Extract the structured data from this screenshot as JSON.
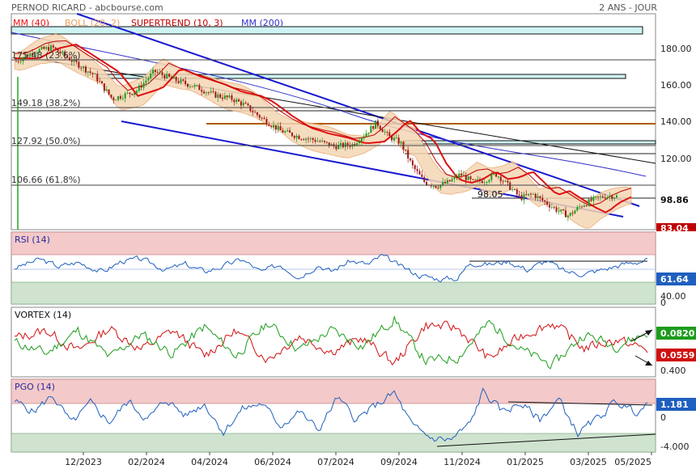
{
  "header": {
    "title": "PERNOD RICARD - abcbourse.com",
    "period": "2 ANS - JOUR"
  },
  "colors": {
    "candle_up": "#1c9c1c",
    "candle_down": "#a01818",
    "mm40": "#e11",
    "boll": "#e8a060",
    "supertrend": "#c00000",
    "mm200": "#3030c8",
    "trend_blue": "#1818d0",
    "rsi": "#1f5fbf",
    "vortex_plus": "#1c9c1c",
    "vortex_minus": "#d01010",
    "pgo": "#1f5fbf",
    "over_zone": "#f3c9c9",
    "under_zone": "#cfe3cf"
  },
  "chart_data": [
    {
      "panel": "price",
      "type": "candlestick",
      "legend": [
        {
          "label": "MM (40)",
          "color": "#e11"
        },
        {
          "label": "BOLL (20, 2)",
          "color": "#e8a060"
        },
        {
          "label": "SUPERTREND (10, 3)",
          "color": "#c00000"
        },
        {
          "label": "MM (200)",
          "color": "#3030c8"
        }
      ],
      "y_ticks": [
        "180.00",
        "160.00",
        "140.00",
        "120.00"
      ],
      "ylim": [
        82,
        191
      ],
      "fibo_levels": [
        {
          "label": "175.48  (23.6%)",
          "value": 175.48
        },
        {
          "label": "149.18  (38.2%)",
          "value": 149.18
        },
        {
          "label": "127.92  (50.0%)",
          "value": 127.92
        },
        {
          "label": "106.66  (61.8%)",
          "value": 106.66
        }
      ],
      "annotations": [
        {
          "label": "98.05",
          "value": 98.05
        }
      ],
      "last_value": "98.86",
      "min_value": "83.04",
      "path": [
        [
          0,
          167
        ],
        [
          0.03,
          172
        ],
        [
          0.06,
          174
        ],
        [
          0.1,
          166
        ],
        [
          0.13,
          160
        ],
        [
          0.16,
          148
        ],
        [
          0.2,
          152
        ],
        [
          0.23,
          162
        ],
        [
          0.26,
          158
        ],
        [
          0.3,
          154
        ],
        [
          0.33,
          150
        ],
        [
          0.36,
          148
        ],
        [
          0.38,
          145
        ],
        [
          0.41,
          138
        ],
        [
          0.44,
          132
        ],
        [
          0.47,
          129
        ],
        [
          0.5,
          127
        ],
        [
          0.53,
          124
        ],
        [
          0.56,
          125
        ],
        [
          0.58,
          130
        ],
        [
          0.6,
          136
        ],
        [
          0.62,
          129
        ],
        [
          0.64,
          126
        ],
        [
          0.66,
          114
        ],
        [
          0.68,
          106
        ],
        [
          0.7,
          104
        ],
        [
          0.72,
          106
        ],
        [
          0.74,
          110
        ],
        [
          0.76,
          106
        ],
        [
          0.78,
          107
        ],
        [
          0.8,
          110
        ],
        [
          0.82,
          104
        ],
        [
          0.84,
          98
        ],
        [
          0.86,
          100
        ],
        [
          0.88,
          96
        ],
        [
          0.9,
          92
        ],
        [
          0.92,
          89
        ],
        [
          0.94,
          94
        ],
        [
          0.96,
          97
        ],
        [
          0.98,
          99
        ],
        [
          1,
          98.86
        ]
      ]
    },
    {
      "panel": "rsi",
      "type": "line",
      "title": "RSI (14)",
      "y_ticks": [
        "40.00",
        "0"
      ],
      "ylim": [
        0,
        100
      ],
      "overbought": 70,
      "oversold": 30,
      "last_value": "61.64",
      "path": [
        [
          0,
          50
        ],
        [
          0.04,
          62
        ],
        [
          0.07,
          52
        ],
        [
          0.1,
          58
        ],
        [
          0.14,
          45
        ],
        [
          0.17,
          60
        ],
        [
          0.2,
          62
        ],
        [
          0.24,
          48
        ],
        [
          0.27,
          55
        ],
        [
          0.3,
          45
        ],
        [
          0.33,
          53
        ],
        [
          0.36,
          62
        ],
        [
          0.39,
          44
        ],
        [
          0.42,
          55
        ],
        [
          0.45,
          38
        ],
        [
          0.48,
          55
        ],
        [
          0.5,
          45
        ],
        [
          0.53,
          60
        ],
        [
          0.56,
          55
        ],
        [
          0.58,
          67
        ],
        [
          0.61,
          52
        ],
        [
          0.64,
          40
        ],
        [
          0.67,
          35
        ],
        [
          0.7,
          36
        ],
        [
          0.72,
          58
        ],
        [
          0.75,
          55
        ],
        [
          0.78,
          60
        ],
        [
          0.81,
          48
        ],
        [
          0.84,
          60
        ],
        [
          0.87,
          45
        ],
        [
          0.9,
          42
        ],
        [
          0.93,
          48
        ],
        [
          0.96,
          55
        ],
        [
          1,
          61.64
        ]
      ]
    },
    {
      "panel": "vortex",
      "type": "line",
      "title": "VORTEX (14)",
      "y_ticks": [
        "0.400"
      ],
      "ylim": [
        -0.45,
        0.45
      ],
      "last_plus": "0.0820",
      "last_minus": "0.0559",
      "plus_path": [
        [
          0,
          0
        ],
        [
          0.05,
          -0.15
        ],
        [
          0.1,
          0.15
        ],
        [
          0.15,
          -0.2
        ],
        [
          0.2,
          0.1
        ],
        [
          0.25,
          -0.15
        ],
        [
          0.3,
          0.2
        ],
        [
          0.35,
          -0.18
        ],
        [
          0.4,
          0.25
        ],
        [
          0.45,
          -0.1
        ],
        [
          0.5,
          0.15
        ],
        [
          0.55,
          -0.05
        ],
        [
          0.6,
          0.3
        ],
        [
          0.65,
          -0.25
        ],
        [
          0.7,
          -0.2
        ],
        [
          0.75,
          0.25
        ],
        [
          0.8,
          -0.1
        ],
        [
          0.85,
          -0.3
        ],
        [
          0.9,
          0.1
        ],
        [
          0.95,
          -0.05
        ],
        [
          1,
          0.12
        ]
      ],
      "minus_path": [
        [
          0,
          0.05
        ],
        [
          0.05,
          0.15
        ],
        [
          0.1,
          -0.12
        ],
        [
          0.15,
          0.18
        ],
        [
          0.2,
          -0.1
        ],
        [
          0.25,
          0.15
        ],
        [
          0.3,
          -0.18
        ],
        [
          0.35,
          0.15
        ],
        [
          0.4,
          -0.22
        ],
        [
          0.45,
          0.08
        ],
        [
          0.5,
          -0.12
        ],
        [
          0.55,
          0.05
        ],
        [
          0.6,
          -0.28
        ],
        [
          0.65,
          0.22
        ],
        [
          0.7,
          0.18
        ],
        [
          0.75,
          -0.22
        ],
        [
          0.8,
          0.08
        ],
        [
          0.85,
          0.25
        ],
        [
          0.9,
          -0.08
        ],
        [
          0.95,
          0.03
        ],
        [
          1,
          -0.1
        ]
      ]
    },
    {
      "panel": "pgo",
      "type": "line",
      "title": "PGO (14)",
      "y_ticks": [
        "0",
        "-4.000"
      ],
      "ylim": [
        -4.5,
        4.5
      ],
      "upper_band": 1.5,
      "lower_band": -2.5,
      "last_value": "1.181",
      "path": [
        [
          0,
          1.8
        ],
        [
          0.03,
          0.5
        ],
        [
          0.06,
          2.5
        ],
        [
          0.09,
          -1
        ],
        [
          0.12,
          1.5
        ],
        [
          0.15,
          -0.8
        ],
        [
          0.18,
          1.8
        ],
        [
          0.21,
          -0.5
        ],
        [
          0.24,
          2
        ],
        [
          0.27,
          0
        ],
        [
          0.3,
          1.5
        ],
        [
          0.33,
          -2
        ],
        [
          0.36,
          0.8
        ],
        [
          0.39,
          1.5
        ],
        [
          0.42,
          -1.2
        ],
        [
          0.45,
          0.5
        ],
        [
          0.48,
          -1.8
        ],
        [
          0.51,
          2.2
        ],
        [
          0.54,
          -0.5
        ],
        [
          0.57,
          1.2
        ],
        [
          0.6,
          2.8
        ],
        [
          0.63,
          -1.5
        ],
        [
          0.66,
          -2.8
        ],
        [
          0.69,
          -3
        ],
        [
          0.72,
          -1
        ],
        [
          0.74,
          3
        ],
        [
          0.77,
          0.5
        ],
        [
          0.8,
          1.5
        ],
        [
          0.83,
          -0.5
        ],
        [
          0.86,
          2
        ],
        [
          0.89,
          -2.2
        ],
        [
          0.92,
          -0.5
        ],
        [
          0.95,
          1.8
        ],
        [
          0.98,
          0.5
        ],
        [
          1,
          1.181
        ]
      ]
    }
  ],
  "x_ticks": [
    "12/2023",
    "02/2024",
    "04/2024",
    "06/2024",
    "07/2024",
    "09/2024",
    "11/2024",
    "01/2025",
    "03/2025",
    "05/2025"
  ]
}
